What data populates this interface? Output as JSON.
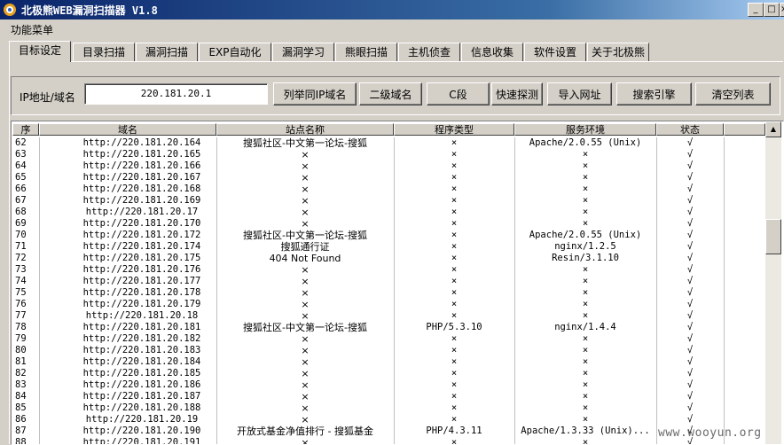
{
  "window": {
    "title": "北极熊WEB漏洞扫描器 V1.8",
    "minimize": "_",
    "maximize": "□",
    "close": "×"
  },
  "menu": {
    "label": "功能菜单"
  },
  "tabs": [
    "目标设定",
    "目录扫描",
    "漏洞扫描",
    "EXP自动化",
    "漏洞学习",
    "熊眼扫描",
    "主机侦查",
    "信息收集",
    "软件设置",
    "关于北极熊"
  ],
  "toolbar": {
    "ip_label": "IP地址/域名",
    "ip_value": "220.181.20.1",
    "buttons": [
      "列举同IP域名",
      "二级域名",
      "C段",
      "快速探测",
      "导入网址",
      "搜索引擎",
      "清空列表"
    ]
  },
  "table": {
    "headers": [
      "序",
      "域名",
      "站点名称",
      "程序类型",
      "服务环境",
      "状态"
    ],
    "rows": [
      [
        "62",
        "http://220.181.20.164",
        "搜狐社区-中文第一论坛-搜狐",
        "×",
        "Apache/2.0.55 (Unix)",
        "√"
      ],
      [
        "63",
        "http://220.181.20.165",
        "×",
        "×",
        "×",
        "√"
      ],
      [
        "64",
        "http://220.181.20.166",
        "×",
        "×",
        "×",
        "√"
      ],
      [
        "65",
        "http://220.181.20.167",
        "×",
        "×",
        "×",
        "√"
      ],
      [
        "66",
        "http://220.181.20.168",
        "×",
        "×",
        "×",
        "√"
      ],
      [
        "67",
        "http://220.181.20.169",
        "×",
        "×",
        "×",
        "√"
      ],
      [
        "68",
        "http://220.181.20.17",
        "×",
        "×",
        "×",
        "√"
      ],
      [
        "69",
        "http://220.181.20.170",
        "×",
        "×",
        "×",
        "√"
      ],
      [
        "70",
        "http://220.181.20.172",
        "搜狐社区-中文第一论坛-搜狐",
        "×",
        "Apache/2.0.55 (Unix)",
        "√"
      ],
      [
        "71",
        "http://220.181.20.174",
        "搜狐通行证",
        "×",
        "nginx/1.2.5",
        "√"
      ],
      [
        "72",
        "http://220.181.20.175",
        "404 Not Found",
        "×",
        "Resin/3.1.10",
        "√"
      ],
      [
        "73",
        "http://220.181.20.176",
        "×",
        "×",
        "×",
        "√"
      ],
      [
        "74",
        "http://220.181.20.177",
        "×",
        "×",
        "×",
        "√"
      ],
      [
        "75",
        "http://220.181.20.178",
        "×",
        "×",
        "×",
        "√"
      ],
      [
        "76",
        "http://220.181.20.179",
        "×",
        "×",
        "×",
        "√"
      ],
      [
        "77",
        "http://220.181.20.18",
        "×",
        "×",
        "×",
        "√"
      ],
      [
        "78",
        "http://220.181.20.181",
        "搜狐社区-中文第一论坛-搜狐",
        "PHP/5.3.10",
        "nginx/1.4.4",
        "√"
      ],
      [
        "79",
        "http://220.181.20.182",
        "×",
        "×",
        "×",
        "√"
      ],
      [
        "80",
        "http://220.181.20.183",
        "×",
        "×",
        "×",
        "√"
      ],
      [
        "81",
        "http://220.181.20.184",
        "×",
        "×",
        "×",
        "√"
      ],
      [
        "82",
        "http://220.181.20.185",
        "×",
        "×",
        "×",
        "√"
      ],
      [
        "83",
        "http://220.181.20.186",
        "×",
        "×",
        "×",
        "√"
      ],
      [
        "84",
        "http://220.181.20.187",
        "×",
        "×",
        "×",
        "√"
      ],
      [
        "85",
        "http://220.181.20.188",
        "×",
        "×",
        "×",
        "√"
      ],
      [
        "86",
        "http://220.181.20.19",
        "×",
        "×",
        "×",
        "√"
      ],
      [
        "87",
        "http://220.181.20.190",
        "开放式基金净值排行 - 搜狐基金",
        "PHP/4.3.11",
        "Apache/1.3.33 (Unix)...",
        "√"
      ],
      [
        "88",
        "http://220.181.20.191",
        "×",
        "×",
        "×",
        "√"
      ]
    ]
  },
  "watermark": "www.wooyun.org"
}
